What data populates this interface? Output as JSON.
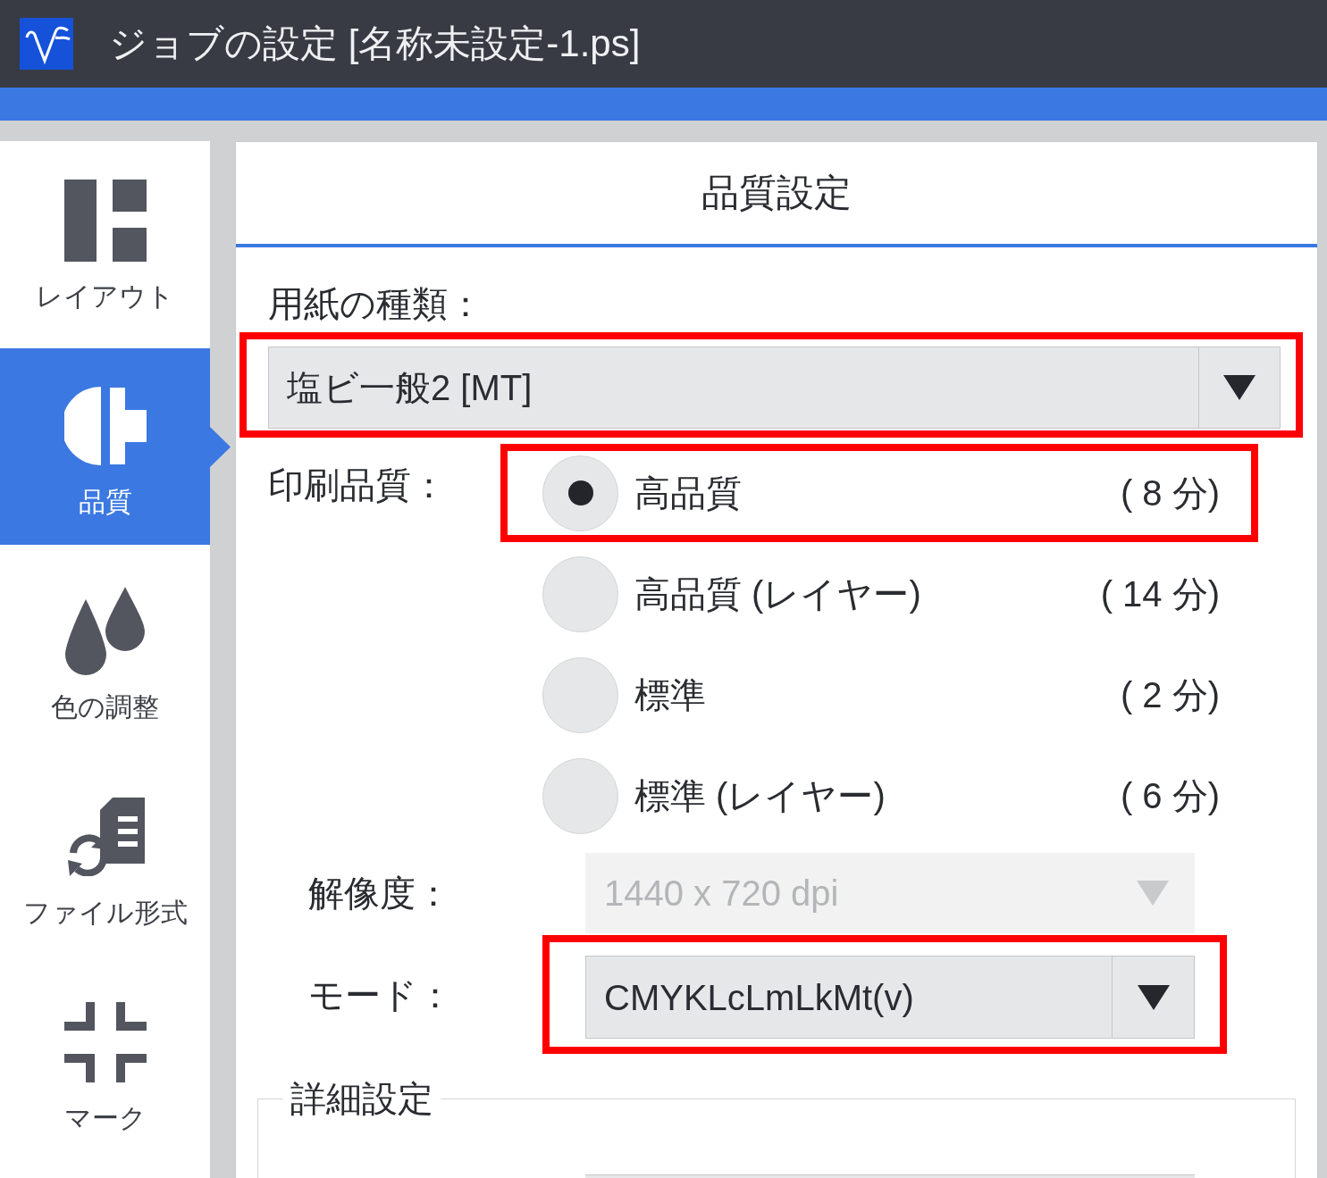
{
  "window": {
    "title": "ジョブの設定 [名称未設定-1.ps]"
  },
  "sidebar": {
    "items": [
      {
        "label": "レイアウト",
        "kind": "layout",
        "selected": false
      },
      {
        "label": "品質",
        "kind": "quality",
        "selected": true
      },
      {
        "label": "色の調整",
        "kind": "color",
        "selected": false
      },
      {
        "label": "ファイル形式",
        "kind": "file",
        "selected": false
      },
      {
        "label": "マーク",
        "kind": "mark",
        "selected": false
      }
    ]
  },
  "panel": {
    "title": "品質設定"
  },
  "paper_type": {
    "label": "用紙の種類：",
    "value": "塩ビ一般2 [MT]",
    "highlighted": true
  },
  "print_quality": {
    "label": "印刷品質：",
    "options": [
      {
        "label": "高品質",
        "duration": "( 8 分)",
        "selected": true,
        "highlighted": true
      },
      {
        "label": "高品質 (レイヤー)",
        "duration": "( 14 分)",
        "selected": false,
        "highlighted": false
      },
      {
        "label": "標準",
        "duration": "( 2 分)",
        "selected": false,
        "highlighted": false
      },
      {
        "label": "標準 (レイヤー)",
        "duration": "( 6 分)",
        "selected": false,
        "highlighted": false
      }
    ]
  },
  "resolution": {
    "label": "解像度：",
    "value": "1440 x 720 dpi",
    "disabled": true
  },
  "mode": {
    "label": "モード：",
    "value": "CMYKLcLmLkMt(v)",
    "highlighted": true
  },
  "details": {
    "title": "詳細設定"
  }
}
